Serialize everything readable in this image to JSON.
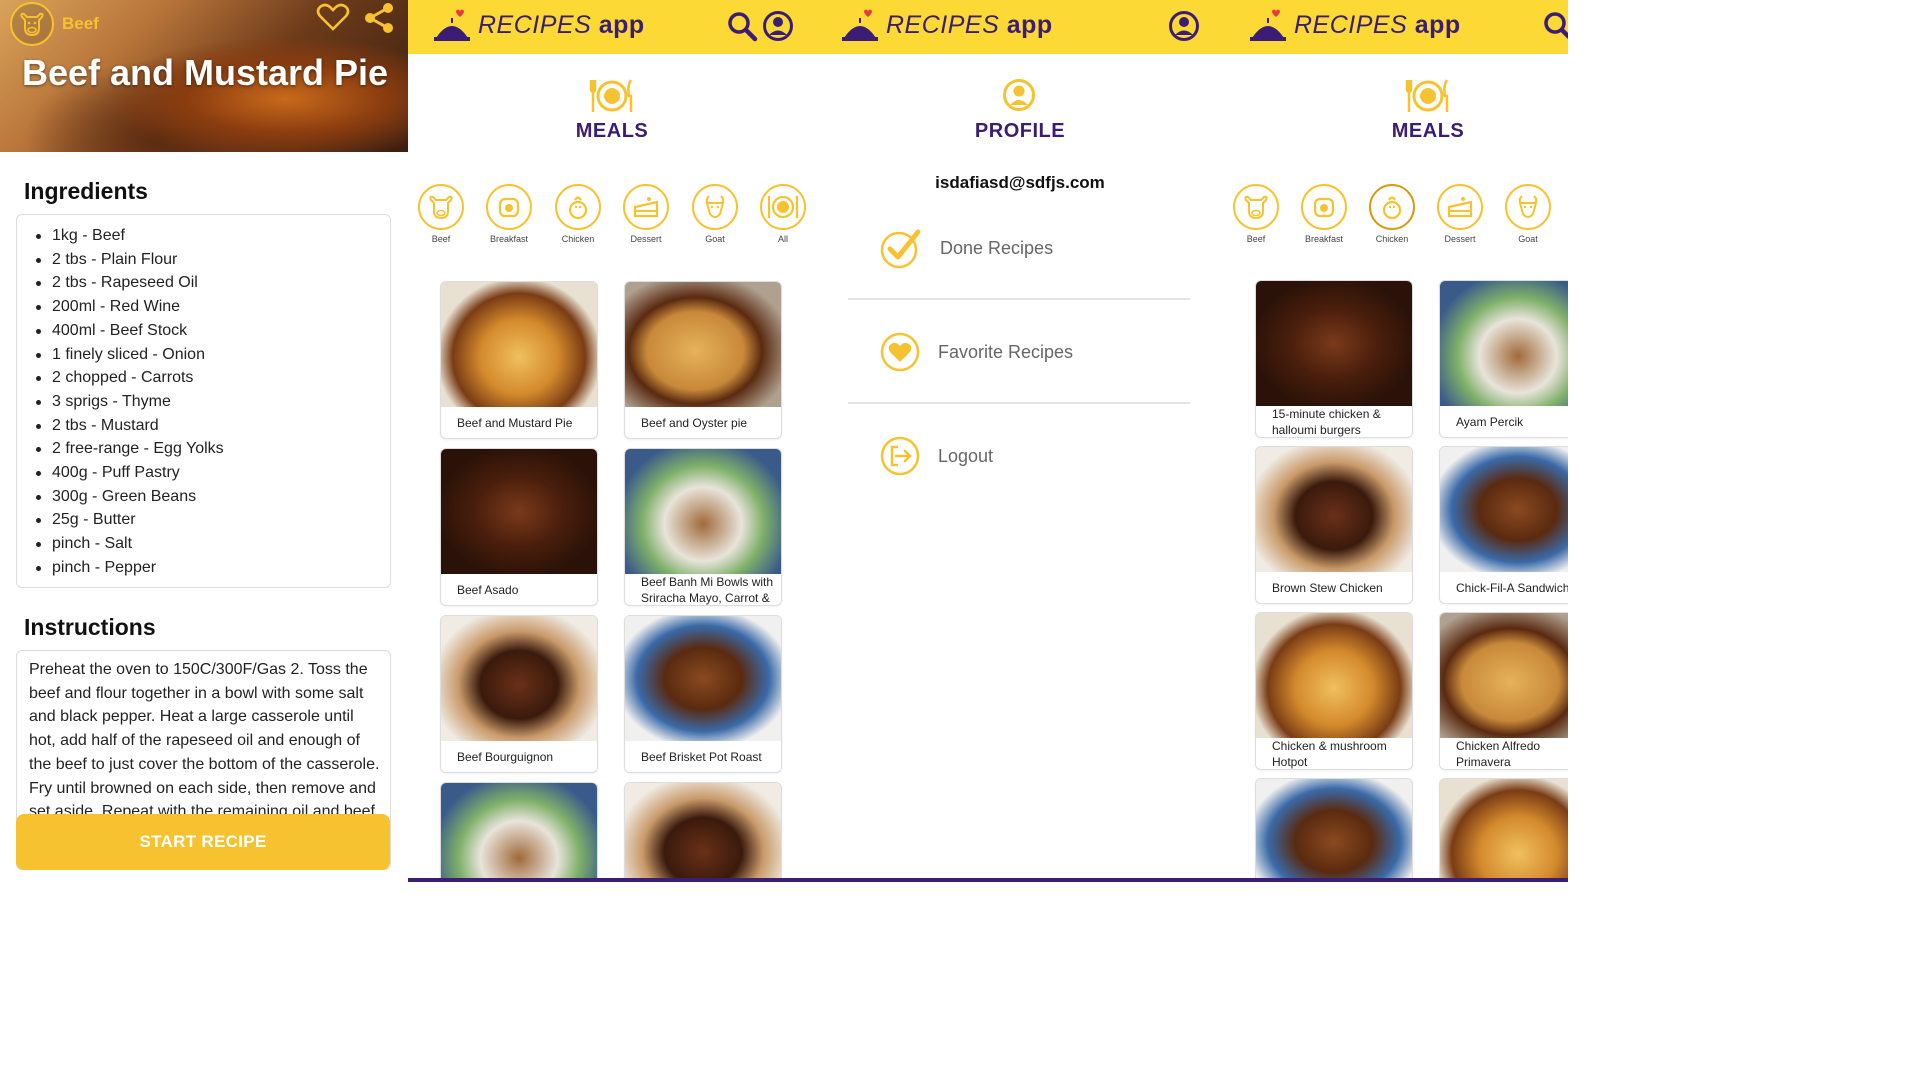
{
  "detail": {
    "category": "Beef",
    "title": "Beef and Mustard Pie",
    "ingredients_heading": "Ingredients",
    "ingredients": [
      "1kg - Beef",
      "2 tbs - Plain Flour",
      "2 tbs - Rapeseed Oil",
      "200ml - Red Wine",
      "400ml - Beef Stock",
      "1 finely sliced - Onion",
      "2 chopped - Carrots",
      "3 sprigs - Thyme",
      "2 tbs - Mustard",
      "2 free-range - Egg Yolks",
      "400g - Puff Pastry",
      "300g - Green Beans",
      "25g - Butter",
      "pinch - Salt",
      "pinch - Pepper"
    ],
    "instructions_heading": "Instructions",
    "instructions": "Preheat the oven to 150C/300F/Gas 2. Toss the beef and flour together in a bowl with some salt and black pepper. Heat a large casserole until hot, add half of the rapeseed oil and enough of the beef to just cover the bottom of the casserole. Fry until browned on each side, then remove and set aside. Repeat with the remaining oil and beef.",
    "start_button": "START RECIPE"
  },
  "app": {
    "logo_word1": "RECIPES",
    "logo_word2": "app",
    "accent": "#fcd934",
    "brand": "#3b1d75",
    "icon_color": "#f7c22f"
  },
  "meals": {
    "title": "MEALS",
    "categories": [
      "Beef",
      "Breakfast",
      "Chicken",
      "Dessert",
      "Goat",
      "All"
    ],
    "recipes": [
      "Beef and Mustard Pie",
      "Beef and Oyster pie",
      "Beef Asado",
      "Beef Banh Mi Bowls with Sriracha Mayo, Carrot & Pickled",
      "Beef Bourguignon",
      "Beef Brisket Pot Roast"
    ]
  },
  "profile": {
    "title": "PROFILE",
    "email": "isdafiasd@sdfjs.com",
    "done": "Done Recipes",
    "favorite": "Favorite Recipes",
    "logout": "Logout"
  },
  "meals_chicken": {
    "title": "MEALS",
    "categories": [
      "Beef",
      "Breakfast",
      "Chicken",
      "Dessert",
      "Goat"
    ],
    "recipes": [
      "15-minute chicken & halloumi burgers",
      "Ayam Percik",
      "Brown Stew Chicken",
      "Chick-Fil-A Sandwich",
      "Chicken & mushroom Hotpot",
      "Chicken Alfredo Primavera"
    ]
  }
}
